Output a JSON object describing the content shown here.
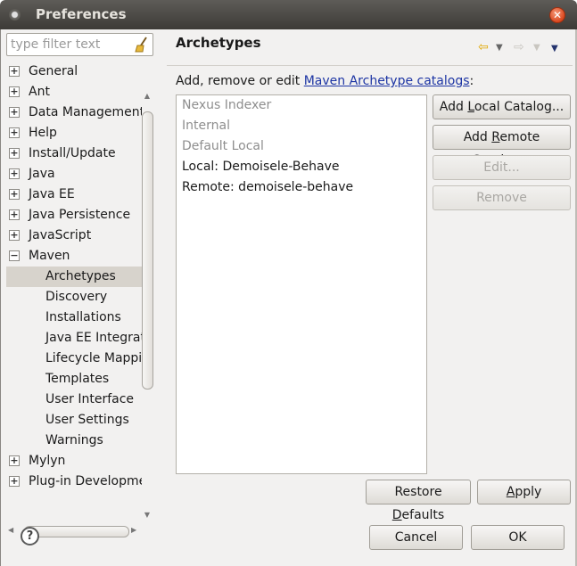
{
  "window": {
    "title": "Preferences"
  },
  "filter": {
    "placeholder": "type filter text"
  },
  "tree": [
    {
      "label": "General",
      "expander": "+",
      "indent": 0,
      "selected": false
    },
    {
      "label": "Ant",
      "expander": "+",
      "indent": 0,
      "selected": false
    },
    {
      "label": "Data Management",
      "expander": "+",
      "indent": 0,
      "selected": false
    },
    {
      "label": "Help",
      "expander": "+",
      "indent": 0,
      "selected": false
    },
    {
      "label": "Install/Update",
      "expander": "+",
      "indent": 0,
      "selected": false
    },
    {
      "label": "Java",
      "expander": "+",
      "indent": 0,
      "selected": false
    },
    {
      "label": "Java EE",
      "expander": "+",
      "indent": 0,
      "selected": false
    },
    {
      "label": "Java Persistence",
      "expander": "+",
      "indent": 0,
      "selected": false
    },
    {
      "label": "JavaScript",
      "expander": "+",
      "indent": 0,
      "selected": false
    },
    {
      "label": "Maven",
      "expander": "−",
      "indent": 0,
      "selected": false
    },
    {
      "label": "Archetypes",
      "expander": "",
      "indent": 1,
      "selected": true
    },
    {
      "label": "Discovery",
      "expander": "",
      "indent": 1,
      "selected": false
    },
    {
      "label": "Installations",
      "expander": "",
      "indent": 1,
      "selected": false
    },
    {
      "label": "Java EE Integrati",
      "expander": "",
      "indent": 1,
      "selected": false
    },
    {
      "label": "Lifecycle Mappin",
      "expander": "",
      "indent": 1,
      "selected": false
    },
    {
      "label": "Templates",
      "expander": "",
      "indent": 1,
      "selected": false
    },
    {
      "label": "User Interface",
      "expander": "",
      "indent": 1,
      "selected": false
    },
    {
      "label": "User Settings",
      "expander": "",
      "indent": 1,
      "selected": false
    },
    {
      "label": "Warnings",
      "expander": "",
      "indent": 1,
      "selected": false
    },
    {
      "label": "Mylyn",
      "expander": "+",
      "indent": 0,
      "selected": false
    },
    {
      "label": "Plug-in Developme",
      "expander": "+",
      "indent": 0,
      "selected": false
    }
  ],
  "page": {
    "title": "Archetypes",
    "description_prefix": "Add, remove or edit ",
    "description_link": "Maven Archetype catalogs",
    "description_suffix": ":"
  },
  "catalogs": [
    {
      "label": "Nexus Indexer",
      "enabled": false
    },
    {
      "label": "Internal",
      "enabled": false
    },
    {
      "label": "Default Local",
      "enabled": false
    },
    {
      "label": "Local: Demoisele-Behave",
      "enabled": true
    },
    {
      "label": "Remote: demoisele-behave",
      "enabled": true
    }
  ],
  "buttons": {
    "add_local": {
      "pre": "Add ",
      "mn": "L",
      "post": "ocal Catalog..."
    },
    "add_remote": {
      "pre": "Add ",
      "mn": "R",
      "post": "emote Catalog..."
    },
    "edit": "Edit...",
    "remove": "Remove",
    "restore_defaults": {
      "pre": "Restore ",
      "mn": "D",
      "post": "efaults"
    },
    "apply": {
      "pre": "",
      "mn": "A",
      "post": "pply"
    },
    "cancel": "Cancel",
    "ok": "OK"
  },
  "colors": {
    "link": "#1d35a4",
    "selection": "#d7d3cc",
    "disabled_text": "#8e8e8e"
  },
  "icons": [
    "help-icon",
    "back-arrow-icon",
    "forward-arrow-icon",
    "menu-dropdown-icon",
    "clear-filter-icon"
  ]
}
